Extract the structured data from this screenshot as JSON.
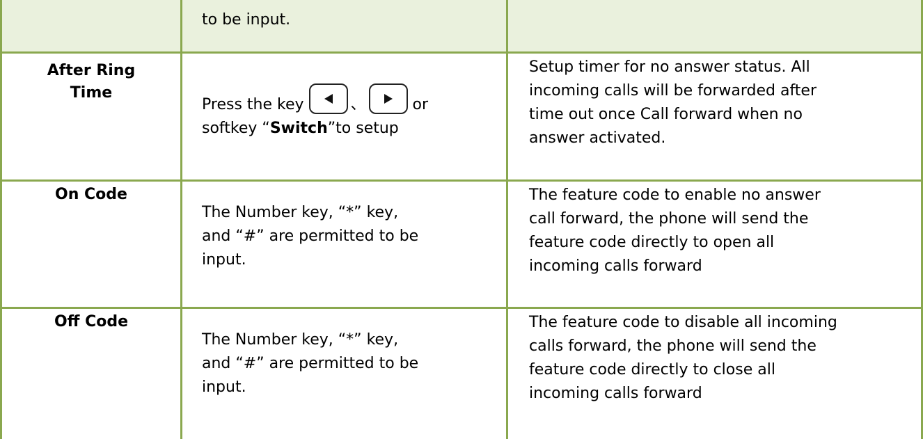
{
  "row0": {
    "desc_tail": "to be input."
  },
  "rows": [
    {
      "name_line1": "After Ring",
      "name_line2": "Time",
      "usage_prefix": "Press the key ",
      "usage_separator": "、",
      "usage_or": " or",
      "usage_line2_prefix": "softkey “",
      "usage_softkey": "Switch",
      "usage_line2_suffix": "”to setup",
      "key_left_icon": "left-arrow-key-icon",
      "key_right_icon": "right-arrow-key-icon",
      "desc_lines": [
        "Setup timer for no answer status. All",
        "incoming calls will be forwarded after",
        "time out once Call forward when no",
        "answer activated."
      ]
    },
    {
      "name_line1": "On Code",
      "usage_lines": [
        "The Number key, “*” key,",
        "and “#” are permitted to be",
        "input."
      ],
      "desc_lines": [
        "The feature code to enable no answer",
        "call forward, the phone will send the",
        "feature code directly to open all",
        "incoming calls forward"
      ]
    },
    {
      "name_line1": "Off Code",
      "usage_lines": [
        "The Number key, “*” key,",
        "and “#” are permitted to be",
        "input."
      ],
      "desc_lines": [
        "The feature code to disable all incoming",
        "calls forward, the phone will send the",
        "feature code directly to close all",
        "incoming calls forward"
      ]
    }
  ],
  "colors": {
    "border": "#8aa84f",
    "shade": "#eaf1dd"
  }
}
